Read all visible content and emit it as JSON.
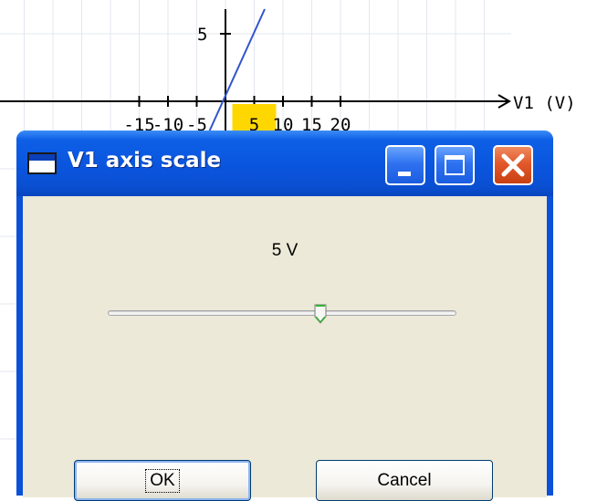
{
  "graph": {
    "x_tick_labels": [
      "-15",
      "-10",
      "-5",
      "5",
      "10",
      "15",
      "20"
    ],
    "y_tick_labels": [
      "5"
    ],
    "x_axis_title": "V1 (V)",
    "highlight_tick": "5",
    "highlight_color": "#ffd700",
    "curve_color": "#3355cc"
  },
  "dialog": {
    "title": "V1 axis scale",
    "value_label": "5 V",
    "slider_value_fraction": 0.61,
    "ok_label": "OK",
    "cancel_label": "Cancel",
    "icons": [
      "window-icon",
      "minimize-icon",
      "maximize-icon",
      "close-icon"
    ],
    "colors": {
      "titlebar": "#0a55de",
      "client": "#ece9d8",
      "close": "#e2582a"
    }
  }
}
